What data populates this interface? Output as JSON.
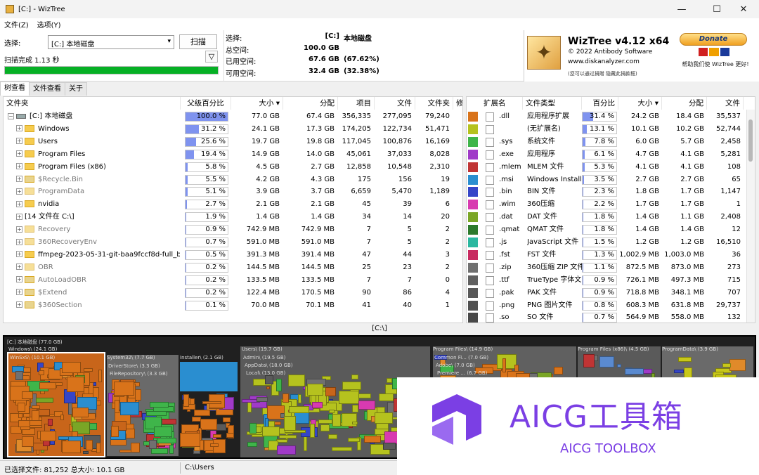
{
  "window": {
    "title": "[C:] - WizTree",
    "minimize": "—",
    "maximize": "☐",
    "close": "✕"
  },
  "menu": {
    "file": "文件(Z)",
    "options": "选项(Y)"
  },
  "toolbar": {
    "select_label": "选择:",
    "drive_value": "[C:] 本地磁盘",
    "scan_button": "扫描",
    "scan_status": "扫描完成 1.13 秒",
    "progress": 1.0
  },
  "summary": {
    "rows": [
      {
        "key": "选择:",
        "v1": "[C:]",
        "v2": "本地磁盘"
      },
      {
        "key": "总空间:",
        "v1": "100.0 GB",
        "v2": ""
      },
      {
        "key": "已用空间:",
        "v1": "67.6 GB",
        "v2": "(67.62%)"
      },
      {
        "key": "可用空间:",
        "v1": "32.4 GB",
        "v2": "(32.38%)"
      }
    ]
  },
  "branding": {
    "title": "WizTree v4.12 x64",
    "copyright": "© 2022 Antibody Software",
    "url": "www.diskanalyzer.com",
    "note": "(您可以通过捐赠 隐藏此捐款框)",
    "donate": "Donate",
    "donate_note": "帮助我们使 WizTree 更好!"
  },
  "tabs": [
    "树查看",
    "文件查看",
    "关于"
  ],
  "tree": {
    "headers": [
      "文件夹",
      "父级百分比",
      "大小 ▾",
      "分配",
      "项目",
      "文件",
      "文件夹",
      "修"
    ],
    "rows": [
      {
        "name": "[C:] 本地磁盘",
        "pct": "100.0 %",
        "pv": 100,
        "size": "77.0 GB",
        "alloc": "67.4 GB",
        "items": "356,335",
        "files": "277,095",
        "folders": "79,240",
        "icon": "drive",
        "indent": 0
      },
      {
        "name": "Windows",
        "pct": "31.2 %",
        "pv": 31.2,
        "size": "24.1 GB",
        "alloc": "17.3 GB",
        "items": "174,205",
        "files": "122,734",
        "folders": "51,471",
        "icon": "folder",
        "indent": 1
      },
      {
        "name": "Users",
        "pct": "25.6 %",
        "pv": 25.6,
        "size": "19.7 GB",
        "alloc": "19.8 GB",
        "items": "117,045",
        "files": "100,876",
        "folders": "16,169",
        "icon": "folder",
        "indent": 1
      },
      {
        "name": "Program Files",
        "pct": "19.4 %",
        "pv": 19.4,
        "size": "14.9 GB",
        "alloc": "14.0 GB",
        "items": "45,061",
        "files": "37,033",
        "folders": "8,028",
        "icon": "folder",
        "indent": 1
      },
      {
        "name": "Program Files (x86)",
        "pct": "5.8 %",
        "pv": 5.8,
        "size": "4.5 GB",
        "alloc": "2.7 GB",
        "items": "12,858",
        "files": "10,548",
        "folders": "2,310",
        "icon": "folder",
        "indent": 1
      },
      {
        "name": "$Recycle.Bin",
        "pct": "5.5 %",
        "pv": 5.5,
        "size": "4.2 GB",
        "alloc": "4.3 GB",
        "items": "175",
        "files": "156",
        "folders": "19",
        "icon": "gear",
        "indent": 1
      },
      {
        "name": "ProgramData",
        "pct": "5.1 %",
        "pv": 5.1,
        "size": "3.9 GB",
        "alloc": "3.7 GB",
        "items": "6,659",
        "files": "5,470",
        "folders": "1,189",
        "icon": "grey",
        "indent": 1
      },
      {
        "name": "nvidia",
        "pct": "2.7 %",
        "pv": 2.7,
        "size": "2.1 GB",
        "alloc": "2.1 GB",
        "items": "45",
        "files": "39",
        "folders": "6",
        "icon": "folder",
        "indent": 1
      },
      {
        "name": "[14 文件在 C:\\]",
        "pct": "1.9 %",
        "pv": 1.9,
        "size": "1.4 GB",
        "alloc": "1.4 GB",
        "items": "34",
        "files": "14",
        "folders": "20",
        "icon": "none",
        "indent": 1
      },
      {
        "name": "Recovery",
        "pct": "0.9 %",
        "pv": 0.9,
        "size": "742.9 MB",
        "alloc": "742.9 MB",
        "items": "7",
        "files": "5",
        "folders": "2",
        "icon": "grey",
        "indent": 1
      },
      {
        "name": "360RecoveryEnv",
        "pct": "0.7 %",
        "pv": 0.7,
        "size": "591.0 MB",
        "alloc": "591.0 MB",
        "items": "7",
        "files": "5",
        "folders": "2",
        "icon": "grey",
        "indent": 1
      },
      {
        "name": "ffmpeg-2023-05-31-git-baa9fccf8d-full_b",
        "pct": "0.5 %",
        "pv": 0.5,
        "size": "391.3 MB",
        "alloc": "391.4 MB",
        "items": "47",
        "files": "44",
        "folders": "3",
        "icon": "folder",
        "indent": 1
      },
      {
        "name": "OBR",
        "pct": "0.2 %",
        "pv": 0.2,
        "size": "144.5 MB",
        "alloc": "144.5 MB",
        "items": "25",
        "files": "23",
        "folders": "2",
        "icon": "grey",
        "indent": 1
      },
      {
        "name": "AutoLoadOBR",
        "pct": "0.2 %",
        "pv": 0.2,
        "size": "133.5 MB",
        "alloc": "133.5 MB",
        "items": "7",
        "files": "7",
        "folders": "0",
        "icon": "gear",
        "indent": 1
      },
      {
        "name": "$Extend",
        "pct": "0.2 %",
        "pv": 0.2,
        "size": "122.4 MB",
        "alloc": "170.5 MB",
        "items": "90",
        "files": "86",
        "folders": "4",
        "icon": "gear",
        "indent": 1
      },
      {
        "name": "$360Section",
        "pct": "0.1 %",
        "pv": 0.1,
        "size": "70.0 MB",
        "alloc": "70.1 MB",
        "items": "41",
        "files": "40",
        "folders": "1",
        "icon": "gear",
        "indent": 1
      }
    ]
  },
  "ext": {
    "headers": [
      "扩展名",
      "文件类型",
      "百分比",
      "大小 ▾",
      "分配",
      "文件"
    ],
    "rows": [
      {
        "ext": ".dll",
        "type": "应用程序扩展",
        "pct": "31.4 %",
        "pv": 31.4,
        "size": "24.2 GB",
        "alloc": "18.4 GB",
        "files": "35,537",
        "color": "#d9731a"
      },
      {
        "ext": "",
        "type": "(无扩展名)",
        "pct": "13.1 %",
        "pv": 13.1,
        "size": "10.1 GB",
        "alloc": "10.2 GB",
        "files": "52,744",
        "color": "#b5c21e"
      },
      {
        "ext": ".sys",
        "type": "系统文件",
        "pct": "7.8 %",
        "pv": 7.8,
        "size": "6.0 GB",
        "alloc": "5.7 GB",
        "files": "2,458",
        "color": "#3fb54a"
      },
      {
        "ext": ".exe",
        "type": "应用程序",
        "pct": "6.1 %",
        "pv": 6.1,
        "size": "4.7 GB",
        "alloc": "4.1 GB",
        "files": "5,281",
        "color": "#a03ac8"
      },
      {
        "ext": ".mlem",
        "type": "MLEM 文件",
        "pct": "5.3 %",
        "pv": 5.3,
        "size": "4.1 GB",
        "alloc": "4.1 GB",
        "files": "108",
        "color": "#c03434"
      },
      {
        "ext": ".msi",
        "type": "Windows Installe",
        "pct": "3.5 %",
        "pv": 3.5,
        "size": "2.7 GB",
        "alloc": "2.7 GB",
        "files": "65",
        "color": "#2a8ed0"
      },
      {
        "ext": ".bin",
        "type": "BIN 文件",
        "pct": "2.3 %",
        "pv": 2.3,
        "size": "1.8 GB",
        "alloc": "1.7 GB",
        "files": "1,147",
        "color": "#3545c8"
      },
      {
        "ext": ".wim",
        "type": "360压缩",
        "pct": "2.2 %",
        "pv": 2.2,
        "size": "1.7 GB",
        "alloc": "1.7 GB",
        "files": "1",
        "color": "#d83ab0"
      },
      {
        "ext": ".dat",
        "type": "DAT 文件",
        "pct": "1.8 %",
        "pv": 1.8,
        "size": "1.4 GB",
        "alloc": "1.1 GB",
        "files": "2,408",
        "color": "#7aa626"
      },
      {
        "ext": ".qmat",
        "type": "QMAT 文件",
        "pct": "1.8 %",
        "pv": 1.8,
        "size": "1.4 GB",
        "alloc": "1.4 GB",
        "files": "12",
        "color": "#2c7a2c"
      },
      {
        "ext": ".js",
        "type": "JavaScript 文件",
        "pct": "1.5 %",
        "pv": 1.5,
        "size": "1.2 GB",
        "alloc": "1.2 GB",
        "files": "16,510",
        "color": "#2ab8a0"
      },
      {
        "ext": ".fst",
        "type": "FST 文件",
        "pct": "1.3 %",
        "pv": 1.3,
        "size": "1,002.9 MB",
        "alloc": "1,003.0 MB",
        "files": "36",
        "color": "#c82a60"
      },
      {
        "ext": ".zip",
        "type": "360压缩 ZIP 文件",
        "pct": "1.1 %",
        "pv": 1.1,
        "size": "872.5 MB",
        "alloc": "873.0 MB",
        "files": "273",
        "color": "#707070"
      },
      {
        "ext": ".ttf",
        "type": "TrueType 字体文",
        "pct": "0.9 %",
        "pv": 0.9,
        "size": "726.1 MB",
        "alloc": "497.3 MB",
        "files": "715",
        "color": "#606060"
      },
      {
        "ext": ".pak",
        "type": "PAK 文件",
        "pct": "0.9 %",
        "pv": 0.9,
        "size": "718.8 MB",
        "alloc": "348.1 MB",
        "files": "707",
        "color": "#585858"
      },
      {
        "ext": ".png",
        "type": "PNG 图片文件",
        "pct": "0.8 %",
        "pv": 0.8,
        "size": "608.3 MB",
        "alloc": "631.8 MB",
        "files": "29,737",
        "color": "#505050"
      },
      {
        "ext": ".so",
        "type": "SO 文件",
        "pct": "0.7 %",
        "pv": 0.7,
        "size": "564.9 MB",
        "alloc": "558.0 MB",
        "files": "132",
        "color": "#484848"
      }
    ]
  },
  "path_label": "[C:\\]",
  "treemap_labels": {
    "root": "[C:] 本地磁盘 (77.0 GB)",
    "windows": "Windows\\ (24.1 GB)",
    "winsxs": "WinSxS\\ (10.1 GB)",
    "system32": "System32\\ (7.7 GB)",
    "driverstore": "DriverStore\\ (3.3 GB)",
    "filerepo": "FileRepository\\ (3.3 GB)",
    "installer": "Installer\\ (2.1 GB)",
    "users": "Users\\ (19.7 GB)",
    "admin": "Admin\\ (19.5 GB)",
    "appdata": "AppData\\ (18.0 GB)",
    "local": "Local\\ (13.0 GB)",
    "programfiles": "Program Files\\ (14.9 GB)",
    "commonfiles": "Common Fi... (7.0 GB)",
    "adobe": "Adobe\\ (7.0 GB)",
    "premiere": "Premiere ... (6.7 GB)",
    "pfx86": "Program Files (x86)\\ (4.5 GB)",
    "programdata": "ProgramData\\ (3.9 GB)"
  },
  "status": {
    "selected": "已选择文件: 81,252  总大小: 10.1 GB",
    "path": "C:\\Users"
  },
  "watermark": {
    "title": "AICG工具箱",
    "subtitle": "AICG TOOLBOX",
    "color": "#7b3fe4"
  }
}
